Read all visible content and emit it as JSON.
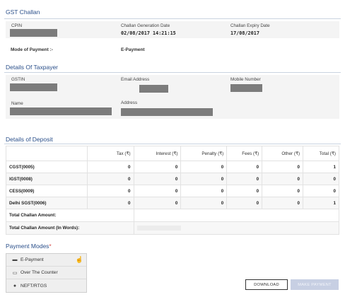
{
  "challan": {
    "title": "GST Challan",
    "cpin_label": "CPIN",
    "gen_date_label": "Challan Generation Date",
    "gen_date": "02/08/2017 14:21:15",
    "exp_date_label": "Challan Expiry Date",
    "exp_date": "17/08/2017",
    "mode_label": "Mode of Payment :-",
    "mode_value": "E-Payment"
  },
  "taxpayer": {
    "title": "Details Of Taxpayer",
    "gstin_label": "GSTIN",
    "email_label": "Email Address",
    "mobile_label": "Mobile Number",
    "name_label": "Name",
    "address_label": "Address"
  },
  "deposit": {
    "title": "Details of Deposit",
    "headers": [
      "",
      "Tax (₹)",
      "Interest (₹)",
      "Penalty (₹)",
      "Fees (₹)",
      "Other (₹)",
      "Total (₹)"
    ],
    "rows": [
      [
        "CGST(0005)",
        "0",
        "0",
        "0",
        "0",
        "0",
        "1"
      ],
      [
        "IGST(0008)",
        "0",
        "0",
        "0",
        "0",
        "0",
        "0"
      ],
      [
        "CESS(0009)",
        "0",
        "0",
        "0",
        "0",
        "0",
        "0"
      ],
      [
        "Delhi SGST(0006)",
        "0",
        "0",
        "0",
        "0",
        "0",
        "1"
      ]
    ],
    "total_label": "Total Challan Amount:",
    "total_words_label": "Total Challan Amount (In Words):"
  },
  "payment_modes": {
    "title": "Payment Modes",
    "required_mark": "*",
    "items": [
      {
        "label": "E-Payment",
        "icon": "card-icon"
      },
      {
        "label": "Over The Counter",
        "icon": "cash-icon"
      },
      {
        "label": "NEFT/RTGS",
        "icon": "globe-icon"
      }
    ]
  },
  "buttons": {
    "download": "DOWNLOAD",
    "make_payment": "MAKE PAYMENT"
  },
  "colors": {
    "section_title": "#2a4f8a",
    "required": "#d9534f",
    "disabled_button": "#c7cfe3"
  }
}
